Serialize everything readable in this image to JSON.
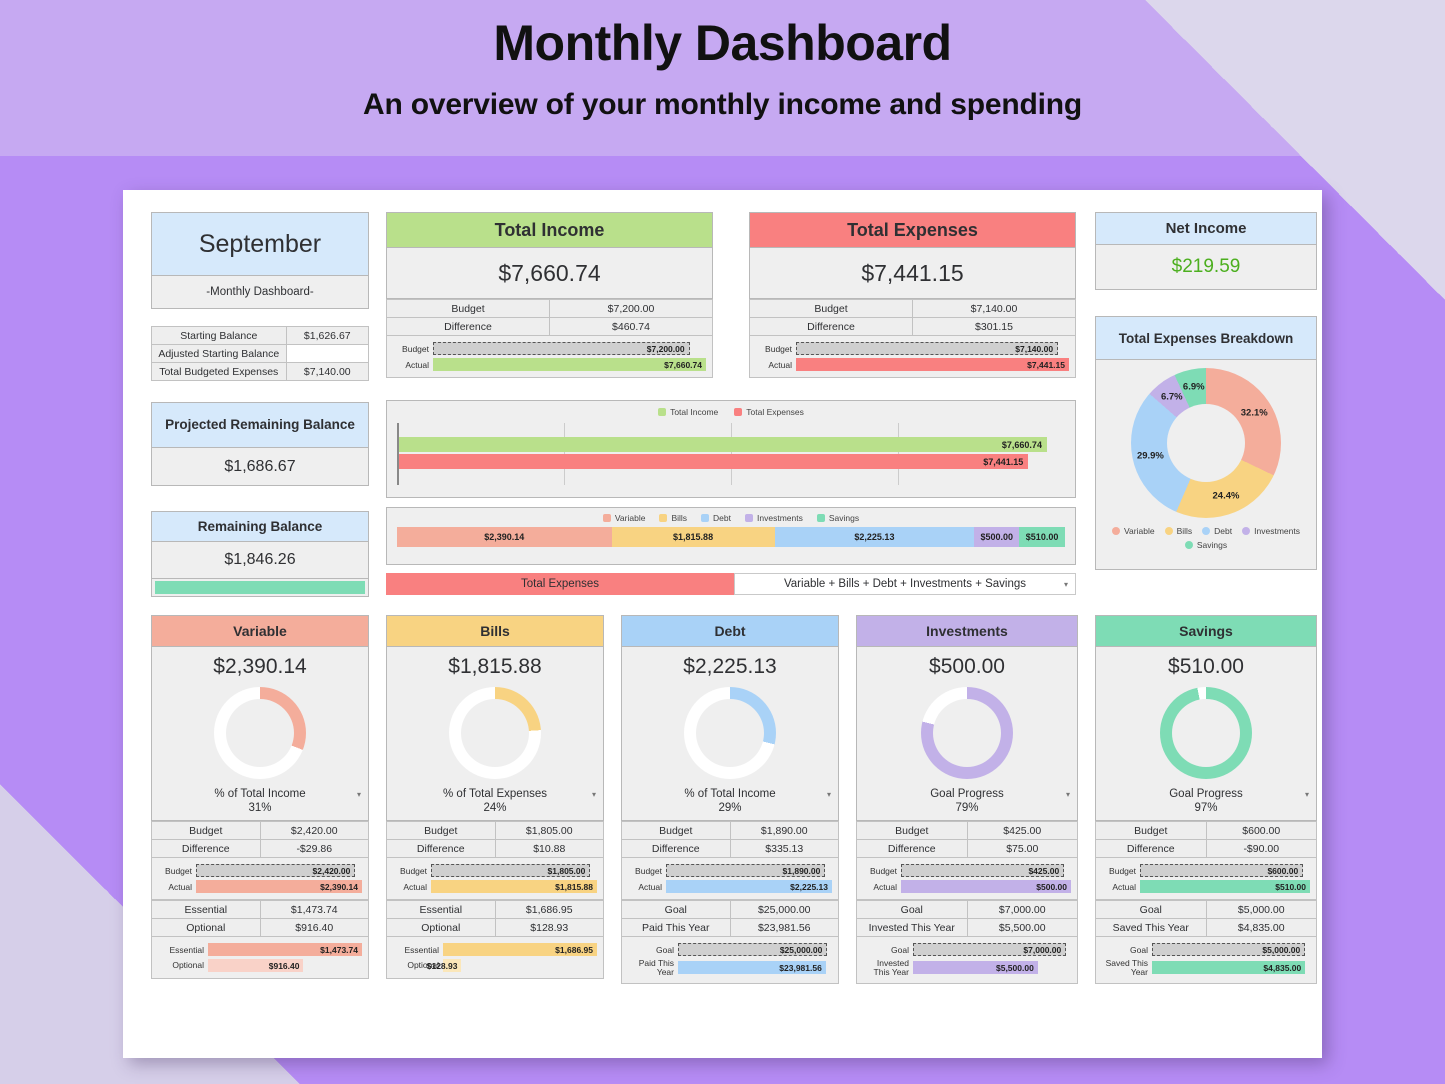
{
  "header": {
    "title": "Monthly Dashboard",
    "subtitle": "An overview of your monthly income and spending"
  },
  "month_card": {
    "month": "September",
    "caption": "-Monthly Dashboard-"
  },
  "balances_table": {
    "rows": [
      {
        "label": "Starting Balance",
        "value": "$1,626.67"
      },
      {
        "label": "Adjusted Starting Balance",
        "value": ""
      },
      {
        "label": "Total Budgeted Expenses",
        "value": "$7,140.00"
      }
    ]
  },
  "projected": {
    "title": "Projected Remaining Balance",
    "value": "$1,686.67"
  },
  "remaining": {
    "title": "Remaining Balance",
    "value": "$1,846.26"
  },
  "total_income": {
    "title": "Total Income",
    "amount": "$7,660.74",
    "budget_label": "Budget",
    "budget_value": "$7,200.00",
    "difference_label": "Difference",
    "difference_value": "$460.74",
    "bar_budget_label": "Budget",
    "bar_budget_value": "$7,200.00",
    "bar_actual_label": "Actual",
    "bar_actual_value": "$7,660.74"
  },
  "total_expenses": {
    "title": "Total Expenses",
    "amount": "$7,441.15",
    "budget_label": "Budget",
    "budget_value": "$7,140.00",
    "difference_label": "Difference",
    "difference_value": "$301.15",
    "bar_budget_label": "Budget",
    "bar_budget_value": "$7,140.00",
    "bar_actual_label": "Actual",
    "bar_actual_value": "$7,441.15"
  },
  "net_income": {
    "title": "Net Income",
    "value": "$219.59"
  },
  "breakdown": {
    "title": "Total Expenses Breakdown",
    "labels": [
      "32.1%",
      "24.4%",
      "29.9%",
      "6.7%",
      "6.9%"
    ],
    "legend": [
      "Variable",
      "Bills",
      "Debt",
      "Investments",
      "Savings"
    ]
  },
  "selector": {
    "left_label": "Total Expenses",
    "right_label": "Variable + Bills + Debt + Investments + Savings"
  },
  "categories": [
    {
      "name": "Variable",
      "color": "#f4ad9b",
      "amount": "$2,390.14",
      "ring_pct": 31,
      "caption": "% of Total Income",
      "pct_text": "31%",
      "budget_label": "Budget",
      "budget_value": "$2,420.00",
      "difference_label": "Difference",
      "difference_value": "-$29.86",
      "difference_sign": "pos",
      "bar_budget_label": "Budget",
      "bar_budget_value": "$2,420.00",
      "bar_actual_label": "Actual",
      "bar_actual_value": "$2,390.14",
      "sub1_label": "Essential",
      "sub1_value": "$1,473.74",
      "sub2_label": "Optional",
      "sub2_value": "$916.40",
      "bar_sub1_label": "Essential",
      "bar_sub1_value": "$1,473.74",
      "bar_sub2_label": "Optional",
      "bar_sub2_value": "$916.40"
    },
    {
      "name": "Bills",
      "color": "#f8d382",
      "amount": "$1,815.88",
      "ring_pct": 24,
      "caption": "% of Total Expenses",
      "pct_text": "24%",
      "budget_label": "Budget",
      "budget_value": "$1,805.00",
      "difference_label": "Difference",
      "difference_value": "$10.88",
      "difference_sign": "neg",
      "bar_budget_label": "Budget",
      "bar_budget_value": "$1,805.00",
      "bar_actual_label": "Actual",
      "bar_actual_value": "$1,815.88",
      "sub1_label": "Essential",
      "sub1_value": "$1,686.95",
      "sub2_label": "Optional",
      "sub2_value": "$128.93",
      "bar_sub1_label": "Essential",
      "bar_sub1_value": "$1,686.95",
      "bar_sub2_label": "Optional",
      "bar_sub2_value": "$128.93"
    },
    {
      "name": "Debt",
      "color": "#a9d2f7",
      "amount": "$2,225.13",
      "ring_pct": 29,
      "caption": "% of Total Income",
      "pct_text": "29%",
      "budget_label": "Budget",
      "budget_value": "$1,890.00",
      "difference_label": "Difference",
      "difference_value": "$335.13",
      "difference_sign": "pos",
      "bar_budget_label": "Budget",
      "bar_budget_value": "$1,890.00",
      "bar_actual_label": "Actual",
      "bar_actual_value": "$2,225.13",
      "sub1_label": "Goal",
      "sub1_value": "$25,000.00",
      "sub2_label": "Paid This Year",
      "sub2_value": "$23,981.56",
      "bar_sub1_label": "Goal",
      "bar_sub1_value": "$25,000.00",
      "bar_sub2_label": "Paid This Year",
      "bar_sub2_value": "$23,981.56"
    },
    {
      "name": "Investments",
      "color": "#c2b1e8",
      "amount": "$500.00",
      "ring_pct": 79,
      "caption": "Goal Progress",
      "pct_text": "79%",
      "budget_label": "Budget",
      "budget_value": "$425.00",
      "difference_label": "Difference",
      "difference_value": "$75.00",
      "difference_sign": "pos",
      "bar_budget_label": "Budget",
      "bar_budget_value": "$425.00",
      "bar_actual_label": "Actual",
      "bar_actual_value": "$500.00",
      "sub1_label": "Goal",
      "sub1_value": "$7,000.00",
      "sub2_label": "Invested This Year",
      "sub2_value": "$5,500.00",
      "bar_sub1_label": "Goal",
      "bar_sub1_value": "$7,000.00",
      "bar_sub2_label": "Invested This Year",
      "bar_sub2_value": "$5,500.00"
    },
    {
      "name": "Savings",
      "color": "#7edcb5",
      "amount": "$510.00",
      "ring_pct": 97,
      "caption": "Goal Progress",
      "pct_text": "97%",
      "budget_label": "Budget",
      "budget_value": "$600.00",
      "difference_label": "Difference",
      "difference_value": "-$90.00",
      "difference_sign": "neg",
      "bar_budget_label": "Budget",
      "bar_budget_value": "$600.00",
      "bar_actual_label": "Actual",
      "bar_actual_value": "$510.00",
      "sub1_label": "Goal",
      "sub1_value": "$5,000.00",
      "sub2_label": "Saved This Year",
      "sub2_value": "$4,835.00",
      "bar_sub1_label": "Goal",
      "bar_sub1_value": "$5,000.00",
      "bar_sub2_label": "Saved This Year",
      "bar_sub2_value": "$4,835.00"
    }
  ],
  "chart_data": [
    {
      "type": "bar",
      "title": "",
      "orientation": "horizontal",
      "categories": [
        "Total Income",
        "Total Expenses"
      ],
      "values": [
        7660.74,
        7441.15
      ],
      "labels": [
        "$7,660.74",
        "$7,441.15"
      ],
      "colors": [
        "#b9e08b",
        "#f98080"
      ],
      "legend": [
        "Total Income",
        "Total Expenses"
      ],
      "legend_position": "top",
      "xlim": [
        0,
        8000
      ],
      "grid": true
    },
    {
      "type": "bar",
      "title": "",
      "orientation": "stacked-horizontal",
      "categories": [
        "Variable",
        "Bills",
        "Debt",
        "Investments",
        "Savings"
      ],
      "values": [
        2390.14,
        1815.88,
        2225.13,
        500.0,
        510.0
      ],
      "labels": [
        "$2,390.14",
        "$1,815.88",
        "$2,225.13",
        "$500.00",
        "$510.00"
      ],
      "colors": [
        "#f4ad9b",
        "#f8d382",
        "#a9d2f7",
        "#c2b1e8",
        "#7edcb5"
      ],
      "legend": [
        "Variable",
        "Bills",
        "Debt",
        "Investments",
        "Savings"
      ],
      "legend_position": "top",
      "total": 7441.15,
      "grid": false
    },
    {
      "type": "pie",
      "subtype": "donut",
      "title": "Total Expenses Breakdown",
      "categories": [
        "Variable",
        "Bills",
        "Debt",
        "Investments",
        "Savings"
      ],
      "values": [
        32.1,
        24.4,
        29.9,
        6.7,
        6.9
      ],
      "labels": [
        "32.1%",
        "24.4%",
        "29.9%",
        "6.7%",
        "6.9%"
      ],
      "colors": [
        "#f4ad9b",
        "#f8d382",
        "#a9d2f7",
        "#c2b1e8",
        "#7edcb5"
      ],
      "legend": [
        "Variable",
        "Bills",
        "Debt",
        "Investments",
        "Savings"
      ],
      "legend_position": "bottom"
    }
  ]
}
